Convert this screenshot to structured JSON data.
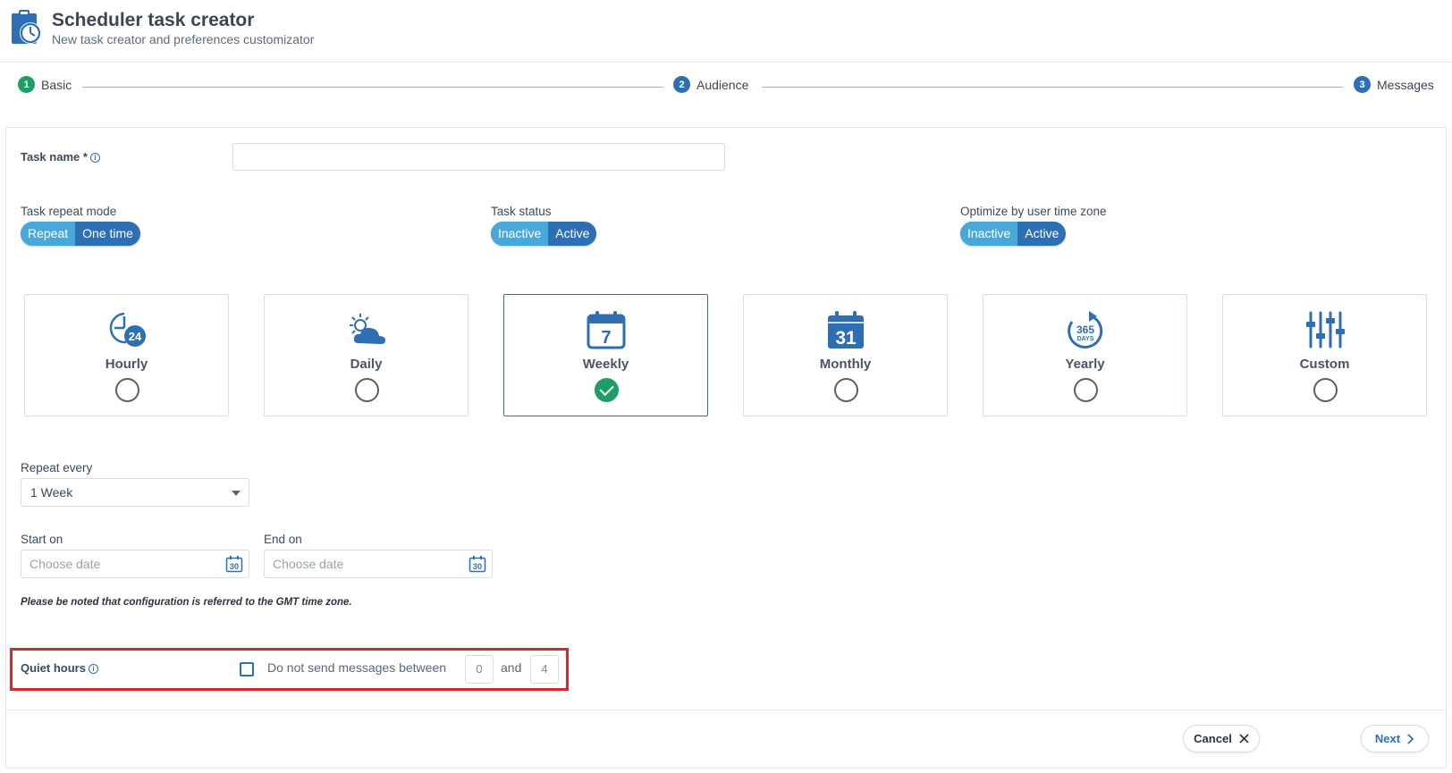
{
  "header": {
    "title": "Scheduler task creator",
    "subtitle": "New task creator and preferences customizator",
    "logo_icon": "clipboard-stopwatch-icon"
  },
  "stepper": [
    {
      "num": "1",
      "label": "Basic",
      "state": "done"
    },
    {
      "num": "2",
      "label": "Audience",
      "state": "pending"
    },
    {
      "num": "3",
      "label": "Messages",
      "state": "pending"
    }
  ],
  "form": {
    "task_name_label": "Task name *",
    "task_name_value": "",
    "repeat_mode": {
      "label": "Task repeat mode",
      "options": [
        "Repeat",
        "One time"
      ],
      "selected": "Repeat"
    },
    "task_status": {
      "label": "Task status",
      "options": [
        "Inactive",
        "Active"
      ],
      "selected": "Inactive"
    },
    "optimize_tz": {
      "label": "Optimize by user time zone",
      "options": [
        "Inactive",
        "Active"
      ],
      "selected": "Inactive"
    },
    "frequencies": [
      {
        "label": "Hourly",
        "icon": "clock-24-icon",
        "selected": false
      },
      {
        "label": "Daily",
        "icon": "sun-cloud-icon",
        "selected": false
      },
      {
        "label": "Weekly",
        "icon": "calendar-7-icon",
        "selected": true,
        "icon_text": "7"
      },
      {
        "label": "Monthly",
        "icon": "calendar-31-icon",
        "selected": false,
        "icon_text": "31"
      },
      {
        "label": "Yearly",
        "icon": "365-days-icon",
        "selected": false,
        "icon_text": "365",
        "icon_subtext": "DAYS"
      },
      {
        "label": "Custom",
        "icon": "sliders-icon",
        "selected": false
      }
    ],
    "repeat_every": {
      "label": "Repeat every",
      "value": "1 Week"
    },
    "start_on": {
      "label": "Start on",
      "placeholder": "Choose date"
    },
    "end_on": {
      "label": "End on",
      "placeholder": "Choose date"
    },
    "calendar_icon_text": "30",
    "note": "Please be noted that configuration is referred to the GMT time zone.",
    "quiet_hours": {
      "label": "Quiet hours",
      "checked": false,
      "text_before": "Do not send messages between",
      "from": "0",
      "text_and": "and",
      "to": "4"
    }
  },
  "footer": {
    "cancel_label": "Cancel",
    "next_label": "Next"
  },
  "colors": {
    "primary": "#2e6fb4",
    "success": "#1e9e67",
    "toggle_on": "#4aa8d8",
    "highlight": "#d42a2a"
  }
}
